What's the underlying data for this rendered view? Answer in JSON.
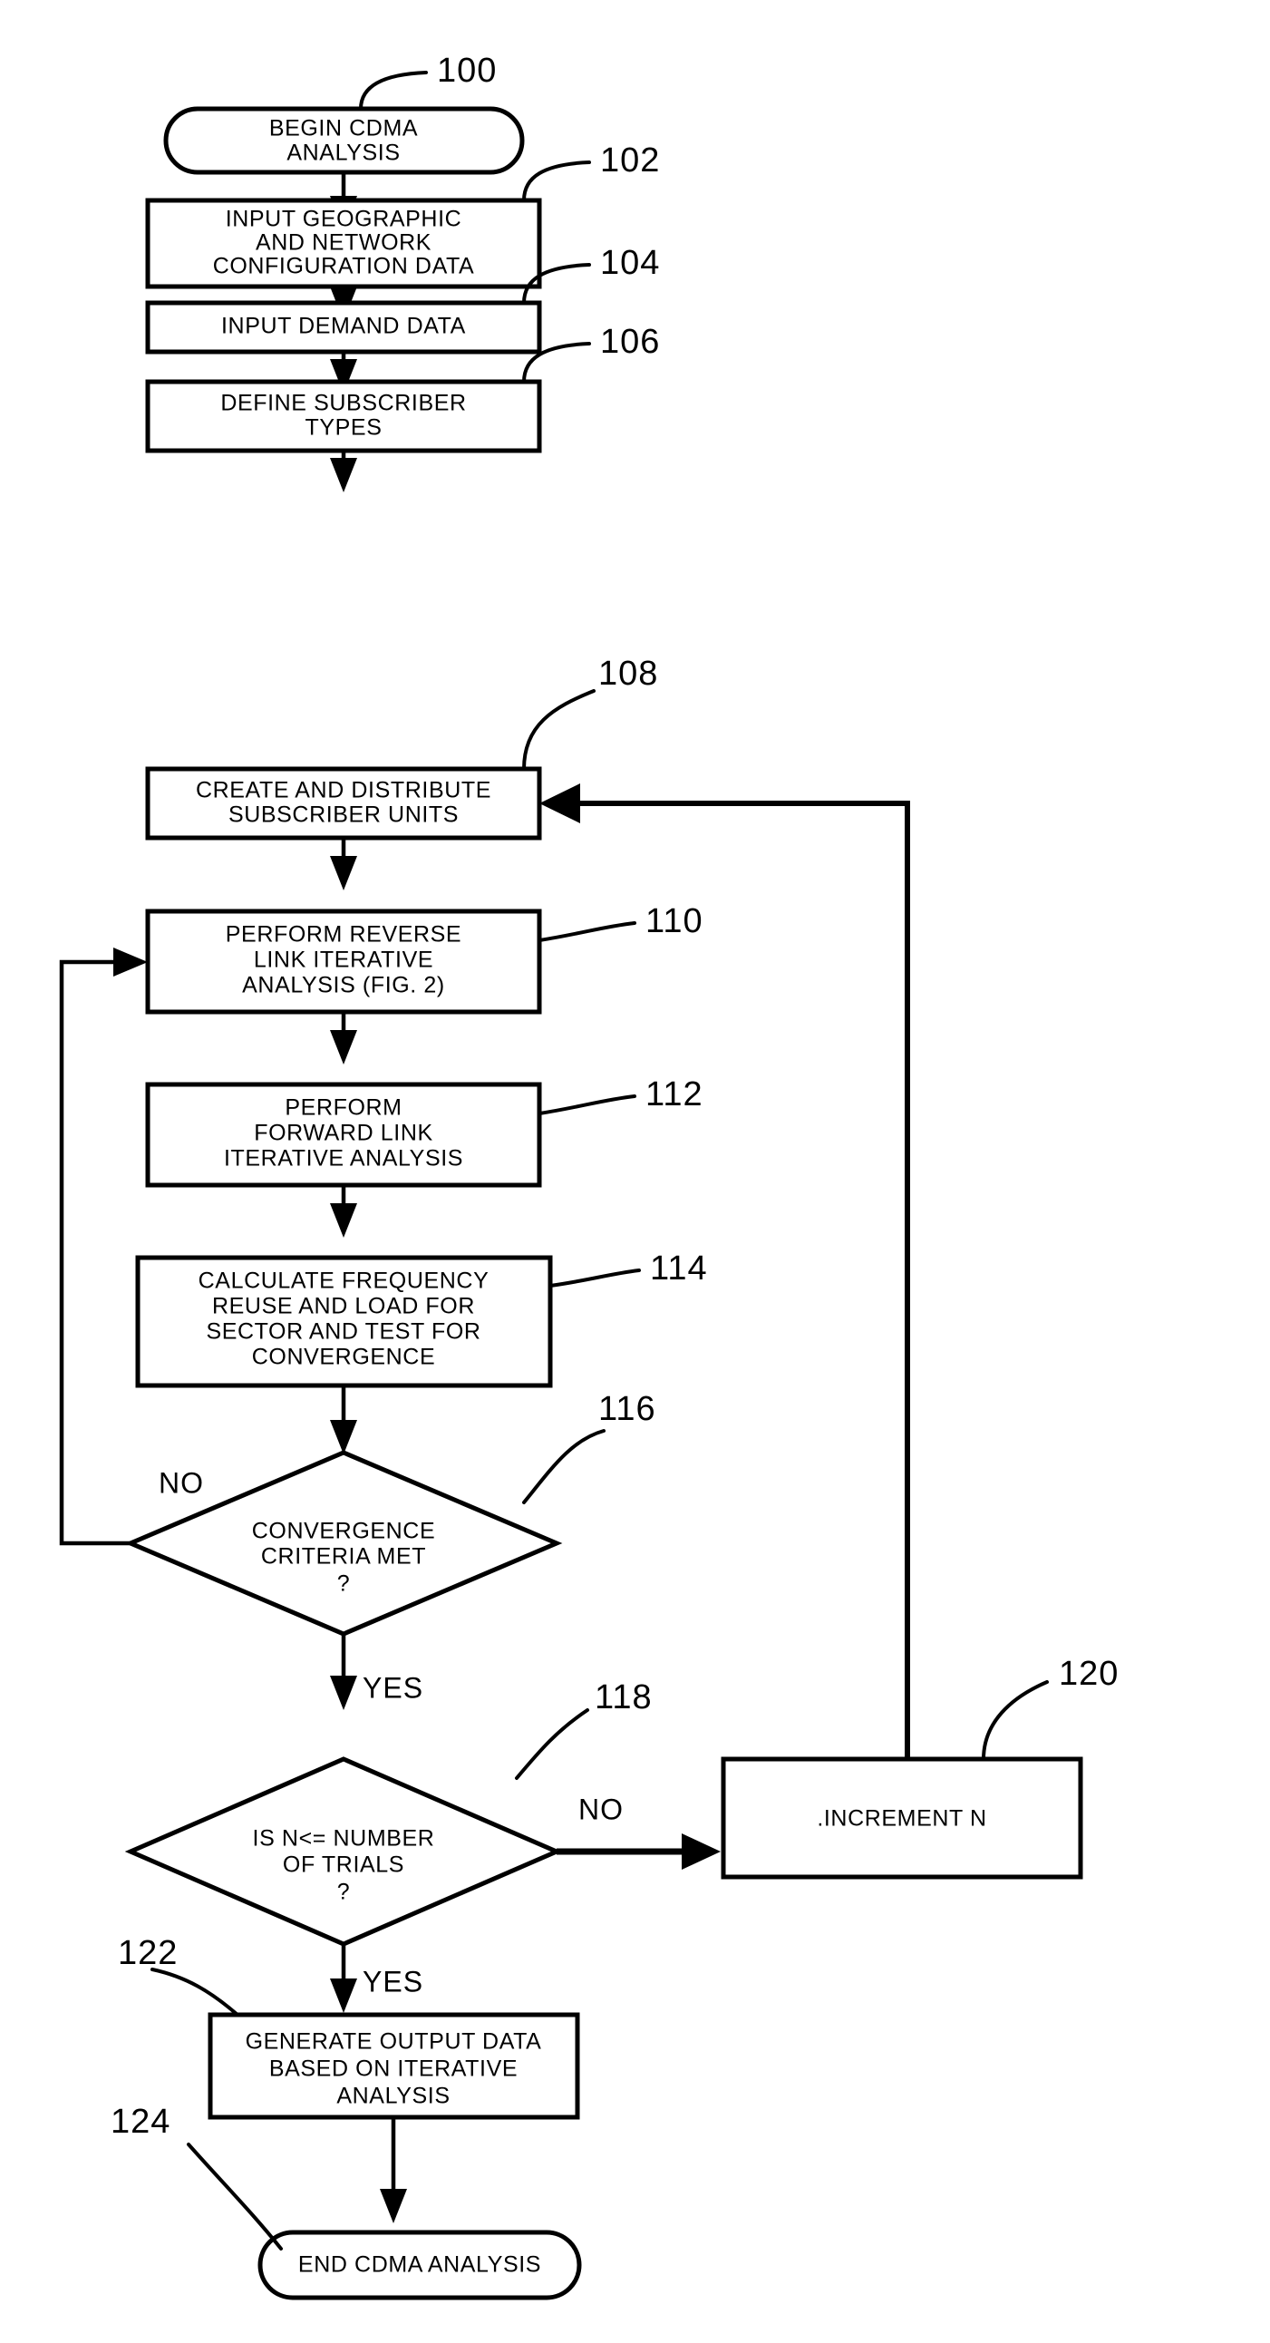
{
  "figure": {
    "kind": "patent-flowchart",
    "title": "CDMA Analysis Flowchart"
  },
  "nodes": {
    "begin": {
      "ref": "100",
      "shape": "terminator",
      "lines": [
        "BEGIN CDMA",
        "ANALYSIS"
      ]
    },
    "input_geo": {
      "ref": "102",
      "shape": "process",
      "lines": [
        "INPUT GEOGRAPHIC",
        "AND NETWORK",
        "CONFIGURATION  DATA"
      ]
    },
    "input_demand": {
      "ref": "104",
      "shape": "process",
      "lines": [
        "INPUT DEMAND DATA"
      ]
    },
    "define_subscriber": {
      "ref": "106",
      "shape": "process",
      "lines": [
        "DEFINE SUBSCRIBER",
        "TYPES"
      ]
    },
    "create_distribute": {
      "ref": "108",
      "shape": "process",
      "lines": [
        "CREATE AND DISTRIBUTE",
        "SUBSCRIBER UNITS"
      ]
    },
    "reverse_link": {
      "ref": "110",
      "shape": "process",
      "lines": [
        "PERFORM REVERSE",
        "LINK ITERATIVE",
        "ANALYSIS (FIG. 2)"
      ]
    },
    "forward_link": {
      "ref": "112",
      "shape": "process",
      "lines": [
        "PERFORM",
        "FORWARD LINK",
        "ITERATIVE ANALYSIS"
      ]
    },
    "calculate_freq": {
      "ref": "114",
      "shape": "process",
      "lines": [
        "CALCULATE FREQUENCY",
        "REUSE AND LOAD FOR",
        "SECTOR AND TEST FOR",
        "CONVERGENCE"
      ]
    },
    "convergence_decision": {
      "ref": "116",
      "shape": "decision",
      "lines": [
        "CONVERGENCE",
        "CRITERIA MET",
        "?"
      ]
    },
    "trials_decision": {
      "ref": "118",
      "shape": "decision",
      "lines": [
        "IS N<= NUMBER",
        "OF TRIALS",
        "?"
      ]
    },
    "increment_n": {
      "ref": "120",
      "shape": "process",
      "lines": [
        ".INCREMENT N"
      ]
    },
    "generate_output": {
      "ref": "122",
      "shape": "process",
      "lines": [
        "GENERATE OUTPUT DATA",
        "BASED ON ITERATIVE",
        "ANALYSIS"
      ]
    },
    "end": {
      "ref": "124",
      "shape": "terminator",
      "lines": [
        "END CDMA ANALYSIS"
      ]
    }
  },
  "branch_labels": {
    "convergence_no": "NO",
    "convergence_yes": "YES",
    "trials_no": "NO",
    "trials_yes": "YES"
  },
  "colors": {
    "ink": "#000000",
    "paper": "#ffffff"
  }
}
